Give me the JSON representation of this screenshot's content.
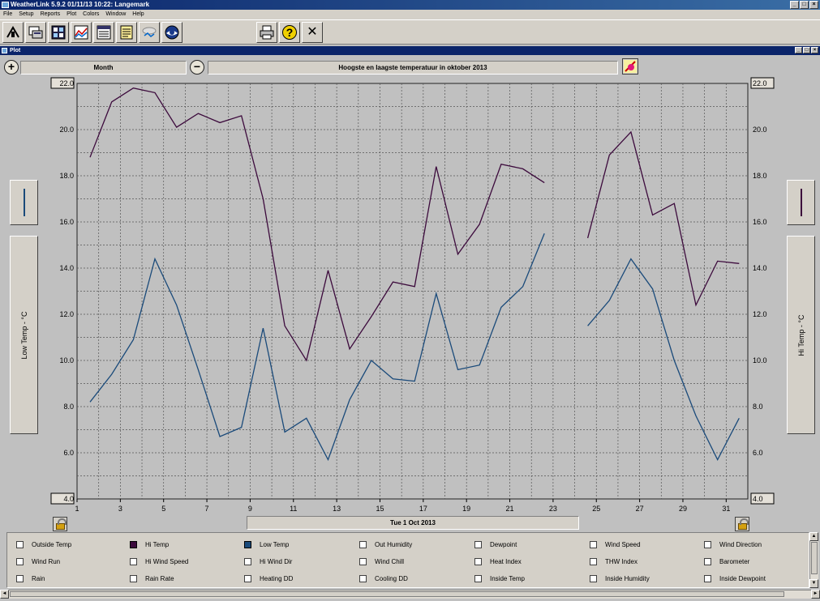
{
  "window": {
    "title": "WeatherLink 5.9.2  01/11/13  10:22: Langemark",
    "minimize": "_",
    "maximize": "□",
    "close": "×"
  },
  "menu": [
    "File",
    "Setup",
    "Reports",
    "Plot",
    "Colors",
    "Window",
    "Help"
  ],
  "toolbar": {
    "icons": [
      "station-icon",
      "bulletin-icon",
      "summary-icon",
      "plot-icon",
      "browse-icon",
      "notes-icon",
      "download-icon",
      "noaa-icon",
      "print-icon",
      "help-icon",
      "close-icon"
    ],
    "help_glyph": "?",
    "close_glyph": "✕",
    "print_glyph": "⎙"
  },
  "subwindow": {
    "title": "Plot",
    "minimize": "_",
    "maximize": "□",
    "close": "×"
  },
  "plot": {
    "zoom_in": "+",
    "zoom_out": "−",
    "period": "Month",
    "title": "Hoogste en laagste temperatuur in oktober 2013",
    "date_label": "Tue 1 Oct 2013",
    "left_axis_label": "Low Temp - °C",
    "right_axis_label": "Hi Temp - °C",
    "colors": {
      "hi": "#3c0a3c",
      "low": "#1a4a7a",
      "grid": "#555555"
    }
  },
  "chart_data": {
    "type": "line",
    "title": "Hoogste en laagste temperatuur in oktober 2013",
    "xlabel": "Tue 1 Oct 2013",
    "ylabel_left": "Low Temp - °C",
    "ylabel_right": "Hi Temp - °C",
    "xlim": [
      1,
      32
    ],
    "ylim": [
      4.0,
      22.0
    ],
    "x_ticks": [
      1,
      3,
      5,
      7,
      9,
      11,
      13,
      15,
      17,
      19,
      21,
      23,
      25,
      27,
      29,
      31
    ],
    "y_ticks": [
      "4.0",
      "6.0",
      "8.0",
      "10.0",
      "12.0",
      "14.0",
      "16.0",
      "18.0",
      "20.0",
      "22.0"
    ],
    "grid": true,
    "series": [
      {
        "name": "Hi Temp",
        "color": "#3c0a3c",
        "segments": [
          [
            [
              1.6,
              18.8
            ],
            [
              2.6,
              21.2
            ],
            [
              3.6,
              21.8
            ],
            [
              4.6,
              21.6
            ],
            [
              5.6,
              20.1
            ],
            [
              6.6,
              20.7
            ],
            [
              7.6,
              20.3
            ],
            [
              8.6,
              20.6
            ],
            [
              9.6,
              17.0
            ],
            [
              10.6,
              11.5
            ],
            [
              11.6,
              10.0
            ],
            [
              12.6,
              13.9
            ],
            [
              13.6,
              10.5
            ],
            [
              14.6,
              11.9
            ],
            [
              15.6,
              13.4
            ],
            [
              16.6,
              13.2
            ],
            [
              17.6,
              18.4
            ],
            [
              18.6,
              14.6
            ],
            [
              19.6,
              15.9
            ],
            [
              20.6,
              18.5
            ],
            [
              21.6,
              18.3
            ],
            [
              22.6,
              17.7
            ]
          ],
          [
            [
              24.6,
              15.3
            ],
            [
              25.6,
              18.9
            ],
            [
              26.6,
              19.9
            ],
            [
              27.6,
              16.3
            ],
            [
              28.6,
              16.8
            ],
            [
              29.6,
              12.4
            ],
            [
              30.6,
              14.3
            ],
            [
              31.6,
              14.2
            ]
          ]
        ]
      },
      {
        "name": "Low Temp",
        "color": "#1a4a7a",
        "segments": [
          [
            [
              1.6,
              8.2
            ],
            [
              2.6,
              9.4
            ],
            [
              3.6,
              10.9
            ],
            [
              4.6,
              14.4
            ],
            [
              5.6,
              12.4
            ],
            [
              6.6,
              9.6
            ],
            [
              7.6,
              6.7
            ],
            [
              8.6,
              7.1
            ],
            [
              9.6,
              11.4
            ],
            [
              10.6,
              6.9
            ],
            [
              11.6,
              7.5
            ],
            [
              12.6,
              5.7
            ],
            [
              13.6,
              8.3
            ],
            [
              14.6,
              10.0
            ],
            [
              15.6,
              9.2
            ],
            [
              16.6,
              9.1
            ],
            [
              17.6,
              12.9
            ],
            [
              18.6,
              9.6
            ],
            [
              19.6,
              9.8
            ],
            [
              20.6,
              12.3
            ],
            [
              21.6,
              13.2
            ],
            [
              22.6,
              15.5
            ]
          ],
          [
            [
              24.6,
              11.5
            ],
            [
              25.6,
              12.6
            ],
            [
              26.6,
              14.4
            ],
            [
              27.6,
              13.1
            ],
            [
              28.6,
              10.0
            ],
            [
              29.6,
              7.6
            ],
            [
              30.6,
              5.7
            ],
            [
              31.6,
              7.5
            ]
          ]
        ]
      }
    ]
  },
  "legend": {
    "items": [
      {
        "label": "Outside Temp",
        "color": null
      },
      {
        "label": "Hi Temp",
        "color": "#3c0a3c"
      },
      {
        "label": "Low Temp",
        "color": "#1a4a7a"
      },
      {
        "label": "Out Humidity",
        "color": null
      },
      {
        "label": "Dewpoint",
        "color": null
      },
      {
        "label": "Wind Speed",
        "color": null
      },
      {
        "label": "Wind Direction",
        "color": null
      },
      {
        "label": "Wind Run",
        "color": null
      },
      {
        "label": "Hi Wind Speed",
        "color": null
      },
      {
        "label": "Hi Wind Dir",
        "color": null
      },
      {
        "label": "Wind Chill",
        "color": null
      },
      {
        "label": "Heat Index",
        "color": null
      },
      {
        "label": "THW Index",
        "color": null
      },
      {
        "label": "Barometer",
        "color": null
      },
      {
        "label": "Rain",
        "color": null
      },
      {
        "label": "Rain Rate",
        "color": null
      },
      {
        "label": "Heating DD",
        "color": null
      },
      {
        "label": "Cooling DD",
        "color": null
      },
      {
        "label": "Inside Temp",
        "color": null
      },
      {
        "label": "Inside Humidity",
        "color": null
      },
      {
        "label": "Inside Dewpoint",
        "color": null
      }
    ]
  },
  "scroll": {
    "up": "▲",
    "down": "▼",
    "left": "◄",
    "right": "►"
  }
}
